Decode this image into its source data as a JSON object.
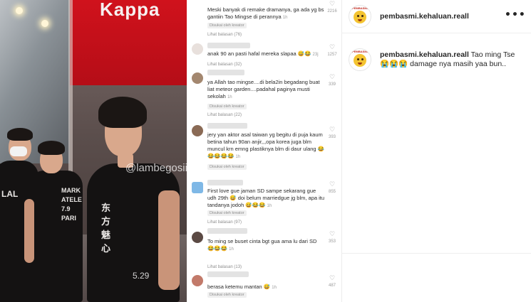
{
  "photo": {
    "store_sign": "Kappa",
    "watermark": "@lambegosiip",
    "shirt_small": "LAL",
    "shirt_main": "MARK\nATELE\n7.9\nPARI",
    "shirt_hero": "东方魅心",
    "video_time": "5.29"
  },
  "comments": [
    {
      "text": "Meski banyak di remake dramanya, ga ada yg bs gantiin Tao Mingse di perannya",
      "time": "1h",
      "badge": "Disukai oleh kreator",
      "reply": "Lihat balasan (76)",
      "likes": "2216"
    },
    {
      "text": "anak 90 an pasti hafal mereka slapaa",
      "emoji": "😅😂",
      "time": "23j",
      "badge": "",
      "reply": "Lihat balasan (32)",
      "likes": "1257"
    },
    {
      "text": "ya Allah tao mingse....di bela2in begadang buat liat meteor garden....padahal paginya musti sekolah",
      "time": "1h",
      "badge": "Disukai oleh kreator",
      "reply": "Lihat balasan (22)",
      "likes": "339"
    },
    {
      "text": "jery yan aktor asal taiwan yg begitu di puja kaum betina tahun 90an anjir,,,opa korea juga blm muncul krn emng plastiknya blm di daur ulang",
      "emoji": "😂😂😂😂😂",
      "time": "1h",
      "badge": "Disukai oleh kreator",
      "reply": "",
      "likes": "393"
    },
    {
      "text": "First love gue jaman SD sampe sekarang gue udh 29th",
      "emoji": "😅",
      "text2": "doi belum marriedgue jg blm, apa itu tandanya jodoh",
      "emoji2": "😅😂😂",
      "time": "1h",
      "badge": "Disukai oleh kreator",
      "reply": "Lihat balasan (97)",
      "likes": "855"
    },
    {
      "text": "To ming se buset cinta bgt gua ama lu dari SD",
      "emoji": "😂😂😂",
      "time": "1h",
      "badge": "",
      "reply": "Lihat balasan (13)",
      "likes": "353"
    },
    {
      "text": "berasa ketemu mantan",
      "emoji": "😅",
      "time": "1h",
      "badge": "Disukai oleh kreator",
      "reply": "",
      "likes": "487"
    }
  ],
  "post": {
    "username": "pembasmi.kehaluan.reall",
    "caption_username": "pembasmi.kehaluan.reall",
    "caption_text": "Tao ming Tse",
    "caption_emoji": "😭😭😭",
    "caption_rest": "damage nya masih yaa bun..",
    "more_label": "•••",
    "avatar_label": "PEMBASMI",
    "icon_avatar": "avatar-icon",
    "icon_more": "more-options-icon",
    "icon_heart": "heart-icon"
  }
}
